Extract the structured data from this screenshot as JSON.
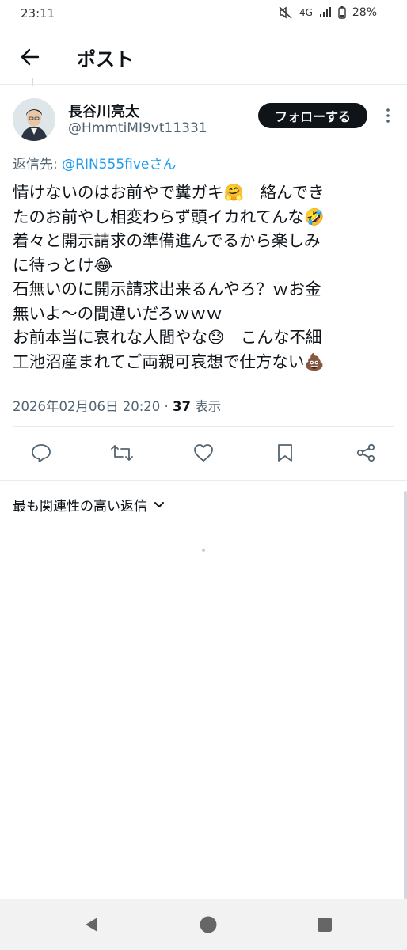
{
  "status_bar": {
    "time": "23:11",
    "network": "4G",
    "battery": "28%"
  },
  "header": {
    "title": "ポスト"
  },
  "author": {
    "display_name": "長谷川亮太",
    "handle": "@HmmtiMI9vt11331",
    "follow_label": "フォローする"
  },
  "reply_to": {
    "label": "返信先: ",
    "mention": "@RIN555fiveさん"
  },
  "tweet": {
    "lines": [
      "情けないのはお前やで糞ガキ🤗　絡んでき",
      "たのお前やし相変わらず頭イカれてんな🤣",
      "着々と開示請求の準備進んでるから楽しみ",
      "に待っとけ😂",
      "石無いのに開示請求出来るんやろ？ｗお金",
      "無いよ～の間違いだろｗｗｗ",
      "お前本当に哀れな人間やな😓　こんな不細",
      "工池沼産まれてご両親可哀想で仕方ない💩"
    ]
  },
  "meta": {
    "timestamp": "2026年02月06日 20:20",
    "separator": " · ",
    "views_count": "37",
    "views_label": " 表示"
  },
  "actions": {
    "reply_icon": "reply-icon",
    "retweet_icon": "retweet-icon",
    "like_icon": "heart-icon",
    "bookmark_icon": "bookmark-icon",
    "share_icon": "share-icon"
  },
  "replies": {
    "sort_label": "最も関連性の高い返信"
  },
  "colors": {
    "accent": "#1d9bf0",
    "text": "#0f1419",
    "secondary": "#536471",
    "follow_bg": "#0f1419"
  }
}
